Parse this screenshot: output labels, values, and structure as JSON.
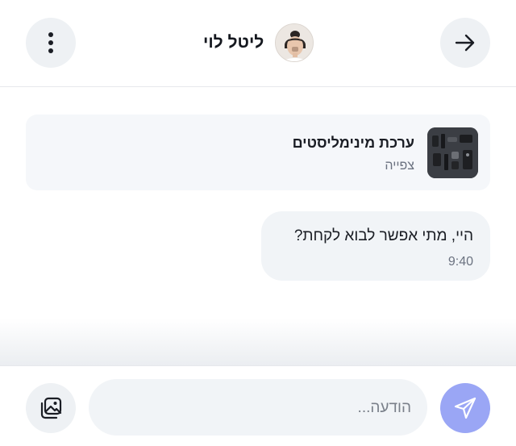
{
  "header": {
    "contact_name": "ליטל לוי",
    "icons": {
      "menu": "more-vertical-icon",
      "back": "arrow-right-icon",
      "avatar": "avatar"
    }
  },
  "product": {
    "title": "ערכת מינימליסטים",
    "status": "צפייה",
    "thumb_icon": "product-thumbnail"
  },
  "messages": [
    {
      "text": "היי, מתי אפשר לבוא לקחת?",
      "time": "9:40"
    }
  ],
  "composer": {
    "placeholder": "הודעה...",
    "value": "",
    "icons": {
      "gallery": "image-gallery-icon",
      "send": "send-icon"
    }
  },
  "colors": {
    "button_bg": "#eef1f4",
    "bubble_bg": "#f1f4f7",
    "send_accent": "#9aa6f5",
    "muted_text": "#6b7280"
  }
}
